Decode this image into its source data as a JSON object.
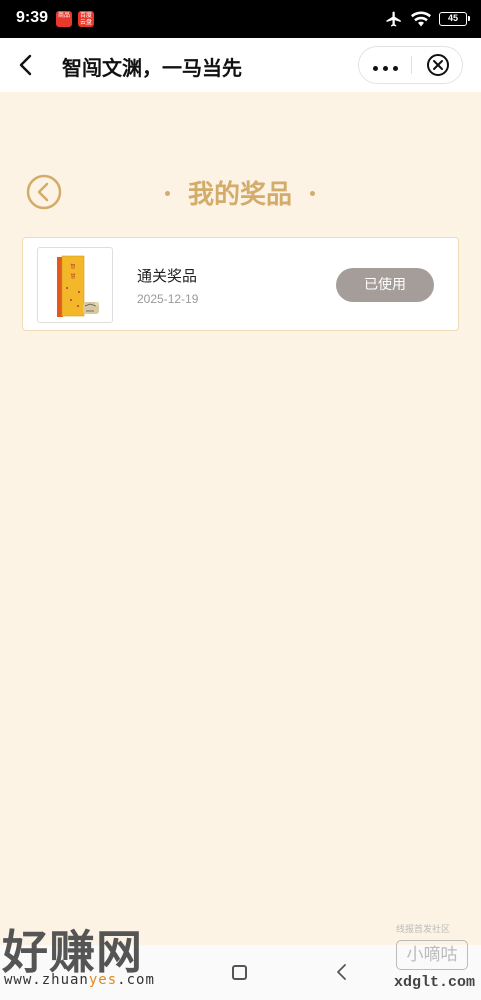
{
  "status_bar": {
    "time": "9:39",
    "app_badges": [
      "商品",
      "百度 云盘"
    ],
    "battery": "45"
  },
  "title_bar": {
    "title": "智闯文渊，一马当先"
  },
  "section": {
    "heading": "我的奖品"
  },
  "prizes": [
    {
      "name": "通关奖品",
      "date": "2025-12-19",
      "status": "已使用"
    }
  ],
  "watermarks": {
    "left_big": "好赚网",
    "left_url_a": "www.zhuan",
    "left_url_b": "yes",
    "left_url_c": ".com",
    "right_small": "线报首发社区",
    "right_box": "小嘀咕",
    "right_domain": "xdglt.com"
  },
  "colors": {
    "background": "#fcf3e4",
    "accent": "#d3ab6b",
    "used_button": "#a59d99"
  }
}
